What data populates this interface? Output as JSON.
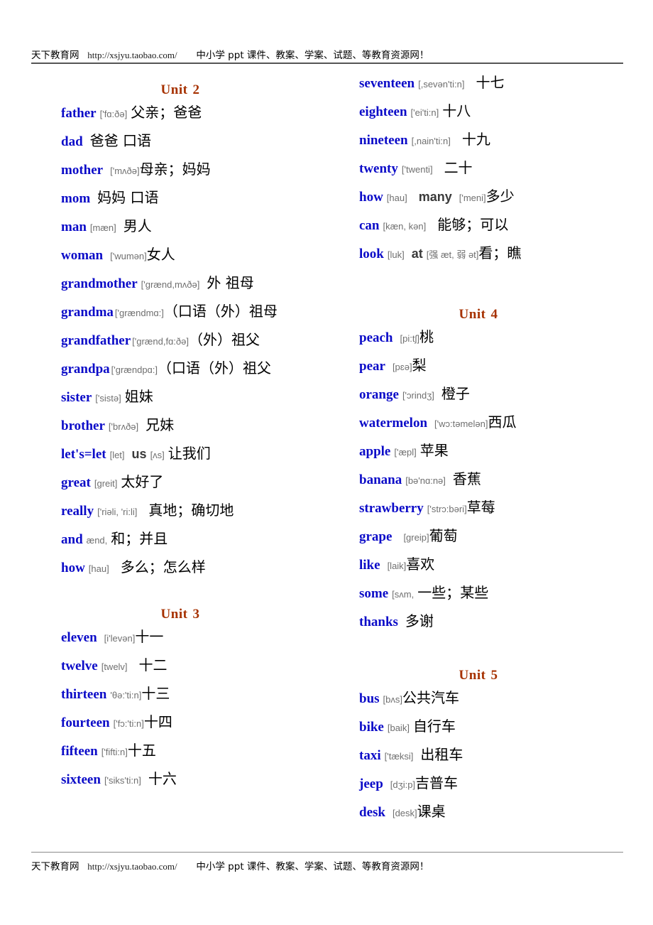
{
  "banner": {
    "site": "天下教育网",
    "url": "http://xsjyu.taobao.com/",
    "tagline": "中小学 ppt 课件、教案、学案、试题、等教育资源网！"
  },
  "units": {
    "unit2": {
      "label": "Unit",
      "number": "2"
    },
    "unit3": {
      "label": "Unit",
      "number": "3"
    },
    "unit4": {
      "label": "Unit",
      "number": "4"
    },
    "unit5": {
      "label": "Unit",
      "number": "5"
    }
  },
  "left_column": {
    "unit2_entries": [
      {
        "word": "father",
        "ipa": "['fɑ:ðə]",
        "zh": "父亲；爸爸"
      },
      {
        "word": "dad",
        "ipa": "",
        "zh": "爸爸 口语"
      },
      {
        "word": "mother",
        "ipa": "['mʌðə]",
        "zh": "母亲；妈妈"
      },
      {
        "word": "mom",
        "ipa": "",
        "zh": "妈妈 口语"
      },
      {
        "word": "man",
        "ipa": "[mæn]",
        "zh": "男人"
      },
      {
        "word": "woman",
        "ipa": "['wumən]",
        "zh": "女人"
      },
      {
        "word": "grandmother",
        "ipa": "['grænd,mʌðə]",
        "zh": "外 祖母"
      },
      {
        "word": "grandma",
        "ipa": "['grændmɑ:]",
        "zh": "（口语（外）祖母"
      },
      {
        "word": "grandfather",
        "ipa": "['grænd,fɑ:ðə]",
        "zh": "（外）祖父"
      },
      {
        "word": "grandpa",
        "ipa": "['grændpɑ:]",
        "zh": "（口语（外）祖父"
      },
      {
        "word": "sister",
        "ipa": "['sistə]",
        "zh": "姐妹"
      },
      {
        "word": "brother",
        "ipa": "['brʌðə]",
        "zh": "兄妹"
      },
      {
        "word": "let's=let",
        "ipa": "[let]",
        "word2": "us",
        "ipa2": "[ʌs]",
        "zh": "让我们"
      },
      {
        "word": "great",
        "ipa": "[greit]",
        "zh": "太好了"
      },
      {
        "word": "really",
        "ipa": "['riəli, 'ri:li]",
        "zh": "真地；确切地"
      },
      {
        "word": "and",
        "ipa": "ænd,",
        "zh": "和；并且"
      },
      {
        "word": "how",
        "ipa": "[hau]",
        "zh": "多么；怎么样"
      }
    ],
    "unit3_entries": [
      {
        "word": "eleven",
        "ipa": "[i'levən]",
        "zh": "十一"
      },
      {
        "word": "twelve",
        "ipa": "[twelv]",
        "zh": "十二"
      },
      {
        "word": "thirteen",
        "ipa": "'θə:'ti:n]",
        "zh": "十三"
      },
      {
        "word": "fourteen",
        "ipa": "['fɔ:'ti:n]",
        "zh": "十四"
      },
      {
        "word": "fifteen",
        "ipa": "['fifti:n]",
        "zh": "十五"
      },
      {
        "word": "sixteen",
        "ipa": "['siks'ti:n]",
        "zh": "十六"
      }
    ]
  },
  "right_column": {
    "unit3_continued_entries": [
      {
        "word": "seventeen",
        "ipa": "[,sevən'ti:n]",
        "zh": "十七"
      },
      {
        "word": "eighteen",
        "ipa": "['ei'ti:n]",
        "zh": "十八"
      },
      {
        "word": "nineteen",
        "ipa": "[,nain'ti:n]",
        "zh": "十九"
      },
      {
        "word": "twenty",
        "ipa": "['twenti]",
        "zh": "二十"
      },
      {
        "word": "how",
        "ipa": "[hau]",
        "word2": "many",
        "ipa2": "['meni]",
        "zh": "多少"
      },
      {
        "word": "can",
        "ipa": "[kæn, kən]",
        "zh": "能够；可以"
      },
      {
        "word": "look",
        "ipa": "[luk]",
        "word2": "at",
        "ipa2": "[强 æt, 弱 ət]",
        "zh": "看；瞧"
      }
    ],
    "unit4_entries": [
      {
        "word": "peach",
        "ipa": "[pi:tʃ]",
        "zh": "桃"
      },
      {
        "word": "pear",
        "ipa": "[pɛə]",
        "zh": "梨"
      },
      {
        "word": "orange",
        "ipa": "['ɔrindʒ]",
        "zh": "橙子"
      },
      {
        "word": "watermelon",
        "ipa": "['wɔ:təmelən]",
        "zh": "西瓜"
      },
      {
        "word": "apple",
        "ipa": "['æpl]",
        "zh": "苹果"
      },
      {
        "word": "banana",
        "ipa": "[bə'nɑ:nə]",
        "zh": "香蕉"
      },
      {
        "word": "strawberry",
        "ipa": "['strɔ:bəri]",
        "zh": "草莓"
      },
      {
        "word": "grape",
        "ipa": "[greip]",
        "zh": "葡萄"
      },
      {
        "word": "like",
        "ipa": "[laik]",
        "zh": "喜欢"
      },
      {
        "word": "some",
        "ipa": "[sʌm,",
        "zh": "一些；某些"
      },
      {
        "word": "thanks",
        "ipa": "",
        "zh": "多谢"
      }
    ],
    "unit5_entries": [
      {
        "word": "bus",
        "ipa": "[bʌs]",
        "zh": "公共汽车"
      },
      {
        "word": "bike",
        "ipa": "[baik]",
        "zh": "自行车"
      },
      {
        "word": "taxi",
        "ipa": "['tæksi]",
        "zh": "出租车"
      },
      {
        "word": "jeep",
        "ipa": "[dʒi:p]",
        "zh": "吉普车"
      },
      {
        "word": "desk",
        "ipa": "[desk]",
        "zh": "课桌"
      }
    ]
  },
  "colors": {
    "word_blue": "#0B0BC8",
    "unit_heading": "#A63100",
    "ipa_gray": "#6f6f6f",
    "page_background": "#ffffff"
  }
}
